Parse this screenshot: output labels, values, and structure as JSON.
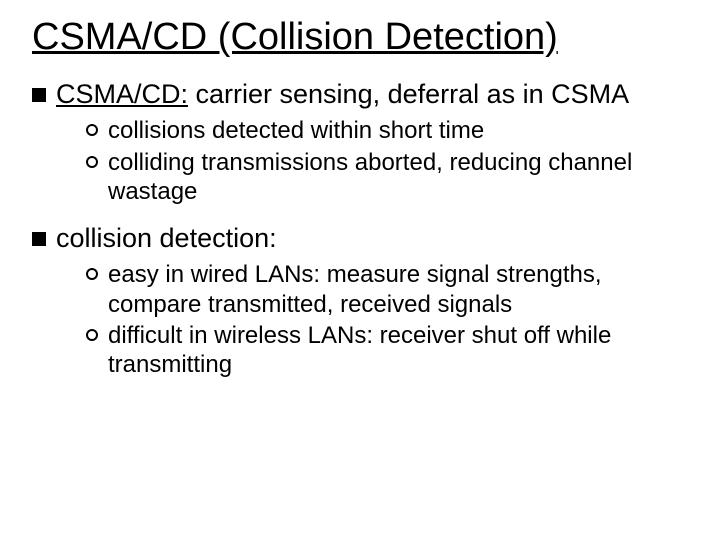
{
  "title": "CSMA/CD (Collision Detection)",
  "lead1": {
    "highlight": "CSMA/CD:",
    "rest": " carrier sensing, deferral as in CSMA"
  },
  "sub1": [
    "collisions detected within short time",
    "colliding transmissions aborted, reducing channel wastage"
  ],
  "lead2": "collision detection:",
  "sub2": [
    "easy in wired LANs: measure signal strengths, compare transmitted, received signals",
    "difficult in wireless LANs: receiver shut off while transmitting"
  ]
}
